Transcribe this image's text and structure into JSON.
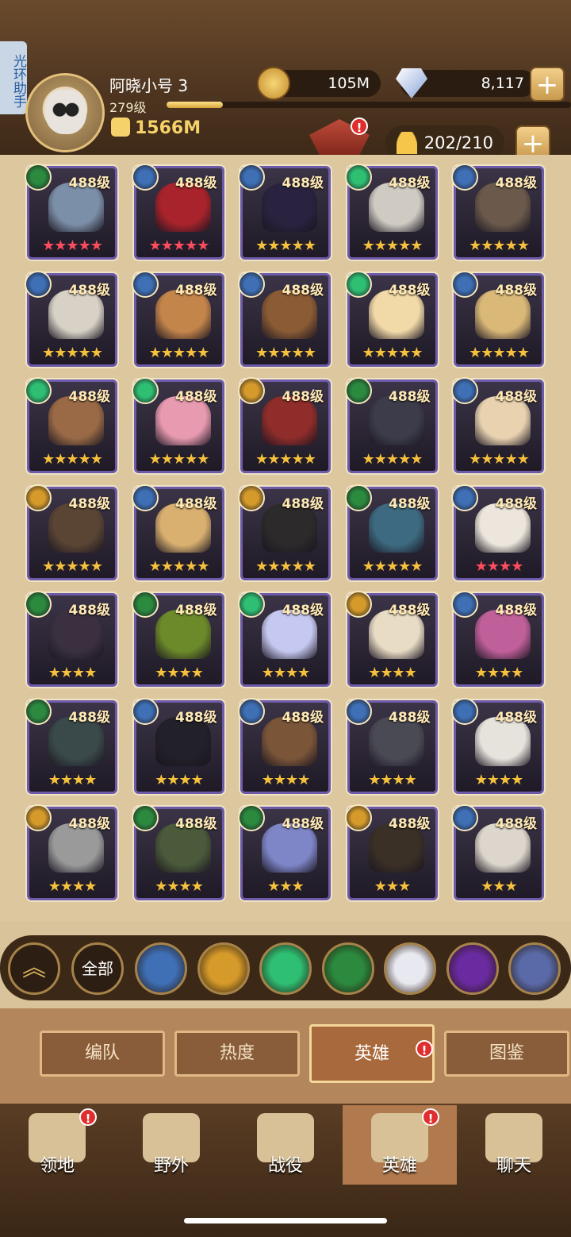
{
  "side_tab": {
    "label": "光环助手"
  },
  "player": {
    "name": "阿晓小号 3",
    "level": "279级",
    "power": "1566M",
    "xp_fraction": 0.14
  },
  "currency": {
    "gold": "105M",
    "gems": "8,117"
  },
  "roster": {
    "count": "202/210"
  },
  "badges": {
    "alert": "!"
  },
  "heroes": [
    {
      "level": "488级",
      "stars": "★★★★★",
      "star_color": "#ff4d5e",
      "faction": "#2b8a3e",
      "portrait": "#7c8fa8"
    },
    {
      "level": "488级",
      "stars": "★★★★★",
      "star_color": "#ff4d5e",
      "faction": "#3f6fb5",
      "portrait": "#a8232b"
    },
    {
      "level": "488级",
      "stars": "★★★★★",
      "star_color": "#f5c13d",
      "faction": "#3f6fb5",
      "portrait": "#2a2340"
    },
    {
      "level": "488级",
      "stars": "★★★★★",
      "star_color": "#f5c13d",
      "faction": "#2fbf73",
      "portrait": "#cfcac2"
    },
    {
      "level": "488级",
      "stars": "★★★★★",
      "star_color": "#f5c13d",
      "faction": "#3f6fb5",
      "portrait": "#6b5a4c"
    },
    {
      "level": "488级",
      "stars": "★★★★★",
      "star_color": "#f5c13d",
      "faction": "#3f6fb5",
      "portrait": "#d8d2c6"
    },
    {
      "level": "488级",
      "stars": "★★★★★",
      "star_color": "#f5c13d",
      "faction": "#3f6fb5",
      "portrait": "#c4854b"
    },
    {
      "level": "488级",
      "stars": "★★★★★",
      "star_color": "#f5c13d",
      "faction": "#3f6fb5",
      "portrait": "#8a5b35"
    },
    {
      "level": "488级",
      "stars": "★★★★★",
      "star_color": "#f5c13d",
      "faction": "#2fbf73",
      "portrait": "#f2d9a8"
    },
    {
      "level": "488级",
      "stars": "★★★★★",
      "star_color": "#f5c13d",
      "faction": "#3f6fb5",
      "portrait": "#d9b878"
    },
    {
      "level": "488级",
      "stars": "★★★★★",
      "star_color": "#f5c13d",
      "faction": "#2fbf73",
      "portrait": "#9a6a46"
    },
    {
      "level": "488级",
      "stars": "★★★★★",
      "star_color": "#f5c13d",
      "faction": "#2fbf73",
      "portrait": "#e89ab0"
    },
    {
      "level": "488级",
      "stars": "★★★★★",
      "star_color": "#f5c13d",
      "faction": "#d59a2a",
      "portrait": "#8e2d2a"
    },
    {
      "level": "488级",
      "stars": "★★★★★",
      "star_color": "#f5c13d",
      "faction": "#2b8a3e",
      "portrait": "#3c3c4a"
    },
    {
      "level": "488级",
      "stars": "★★★★★",
      "star_color": "#f5c13d",
      "faction": "#3f6fb5",
      "portrait": "#e8d2b0"
    },
    {
      "level": "488级",
      "stars": "★★★★★",
      "star_color": "#f5c13d",
      "faction": "#d59a2a",
      "portrait": "#5a4535"
    },
    {
      "level": "488级",
      "stars": "★★★★★",
      "star_color": "#f5c13d",
      "faction": "#3f6fb5",
      "portrait": "#d9b070"
    },
    {
      "level": "488级",
      "stars": "★★★★★",
      "star_color": "#f5c13d",
      "faction": "#d59a2a",
      "portrait": "#2c2a2a"
    },
    {
      "level": "488级",
      "stars": "★★★★★",
      "star_color": "#f5c13d",
      "faction": "#2b8a3e",
      "portrait": "#3d6a80"
    },
    {
      "level": "488级",
      "stars": "★★★★",
      "star_color": "#ff4d5e",
      "faction": "#3f6fb5",
      "portrait": "#ece6dc"
    },
    {
      "level": "488级",
      "stars": "★★★★",
      "star_color": "#f5c13d",
      "faction": "#2b8a3e",
      "portrait": "#3a3040"
    },
    {
      "level": "488级",
      "stars": "★★★★",
      "star_color": "#f5c13d",
      "faction": "#2b8a3e",
      "portrait": "#6c8a2a"
    },
    {
      "level": "488级",
      "stars": "★★★★",
      "star_color": "#f5c13d",
      "faction": "#2fbf73",
      "portrait": "#c5c8f0"
    },
    {
      "level": "488级",
      "stars": "★★★★",
      "star_color": "#f5c13d",
      "faction": "#d59a2a",
      "portrait": "#e9dcc4"
    },
    {
      "level": "488级",
      "stars": "★★★★",
      "star_color": "#f5c13d",
      "faction": "#3f6fb5",
      "portrait": "#c0609a"
    },
    {
      "level": "488级",
      "stars": "★★★★",
      "star_color": "#f5c13d",
      "faction": "#2b8a3e",
      "portrait": "#3a4a4a"
    },
    {
      "level": "488级",
      "stars": "★★★★",
      "star_color": "#f5c13d",
      "faction": "#3f6fb5",
      "portrait": "#222029"
    },
    {
      "level": "488级",
      "stars": "★★★★",
      "star_color": "#f5c13d",
      "faction": "#3f6fb5",
      "portrait": "#7a5538"
    },
    {
      "level": "488级",
      "stars": "★★★★",
      "star_color": "#f5c13d",
      "faction": "#3f6fb5",
      "portrait": "#4a4a55"
    },
    {
      "level": "488级",
      "stars": "★★★★",
      "star_color": "#f5c13d",
      "faction": "#3f6fb5",
      "portrait": "#e6e2dc"
    },
    {
      "level": "488级",
      "stars": "★★★★",
      "star_color": "#f5c13d",
      "faction": "#d59a2a",
      "portrait": "#9a9a9a"
    },
    {
      "level": "488级",
      "stars": "★★★★",
      "star_color": "#f5c13d",
      "faction": "#2b8a3e",
      "portrait": "#4a5a3a"
    },
    {
      "level": "488级",
      "stars": "★★★",
      "star_color": "#f5c13d",
      "faction": "#2b8a3e",
      "portrait": "#7e86c8"
    },
    {
      "level": "488级",
      "stars": "★★★",
      "star_color": "#f5c13d",
      "faction": "#d59a2a",
      "portrait": "#3a3026"
    },
    {
      "level": "488级",
      "stars": "★★★",
      "star_color": "#f5c13d",
      "faction": "#3f6fb5",
      "portrait": "#ddd6cc"
    }
  ],
  "filters": {
    "all_label": "全部",
    "factions": [
      {
        "name": "lightbearer-icon",
        "color": "#3f6fb5"
      },
      {
        "name": "mauler-icon",
        "color": "#d59a2a"
      },
      {
        "name": "wilder-icon",
        "color": "#2fbf73"
      },
      {
        "name": "graveborn-icon",
        "color": "#2b8a3e"
      },
      {
        "name": "celestial-icon",
        "color": "#e8e8f0"
      },
      {
        "name": "hypogean-icon",
        "color": "#6a2aa0"
      },
      {
        "name": "dimensional-icon",
        "color": "#5a6aa8"
      }
    ]
  },
  "tabs": [
    {
      "label": "编队"
    },
    {
      "label": "热度"
    },
    {
      "label": "英雄"
    },
    {
      "label": "图鉴"
    }
  ],
  "nav": [
    {
      "label": "领地"
    },
    {
      "label": "野外"
    },
    {
      "label": "战役"
    },
    {
      "label": "英雄"
    },
    {
      "label": "聊天"
    }
  ]
}
